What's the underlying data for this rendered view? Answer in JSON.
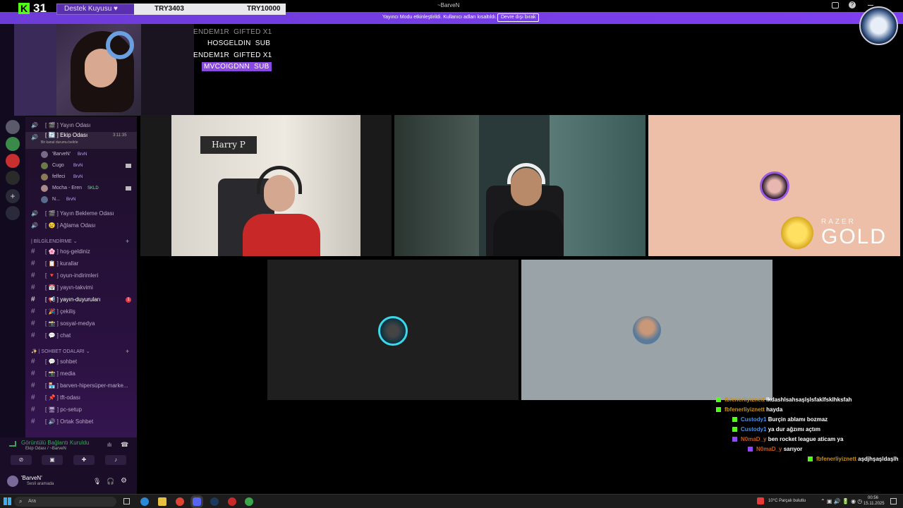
{
  "titlebar": {
    "title": "~BarveN"
  },
  "banner": {
    "text": "Yayıncı Modu etkinleştirildi. Kullanıcı adları kısaltıldı.",
    "button": "Devre dışı bırak"
  },
  "overlay": {
    "kick_count": "31",
    "destek": "Destek Kuyusu ♥",
    "try_left": "TRY3403",
    "try_right": "TRY10000",
    "sub_rows": [
      {
        "name": "ENDEM1R",
        "type": "GIFTED X1"
      },
      {
        "name": "HOSGELDIN",
        "type": "SUB"
      },
      {
        "name": "ENDEM1R",
        "type": "GIFTED X1"
      },
      {
        "name": "MVCOIGDNN",
        "type": "SUB"
      }
    ]
  },
  "sidebar": {
    "voice_top": [
      {
        "label": "[ 🎬 ] Yayın Odası"
      },
      {
        "label": "[ 🔄 ] Ekip Odası",
        "timer": "3:11:35",
        "status": "Bir kanal durumu belirle"
      }
    ],
    "members": [
      {
        "name": "'BarveN'",
        "tag": "BrvN"
      },
      {
        "name": "Cugo",
        "tag": "BrvN"
      },
      {
        "name": "felfeci",
        "tag": "BrvN"
      },
      {
        "name": "Mocha - Eren",
        "tag": "SKLD"
      },
      {
        "name": "N...",
        "tag": "BrvN"
      }
    ],
    "voice_bottom": [
      {
        "label": "[ 🎬 ] Yayın Bekleme Odası"
      },
      {
        "label": "[ 😢 ] Ağlama Odası"
      }
    ],
    "cat1": "| BİLGİLENDİRME ⌄",
    "info_channels": [
      {
        "label": "[ 🌸 ] hoş-geldiniz"
      },
      {
        "label": "[ 📋 ] kurallar"
      },
      {
        "label": "[ 🔻 ] oyun-indirimleri"
      },
      {
        "label": "[ 📅 ] yayın-takvimi"
      },
      {
        "label": "[ 📢 ] yayın-duyuruları",
        "badge": "1"
      },
      {
        "label": "[ 🎉 ] çekiliş"
      },
      {
        "label": "[ 📸 ] sosyal-medya"
      },
      {
        "label": "[ 💬 ] chat"
      }
    ],
    "cat2": "✨ | SOHBET ODALARI ⌄",
    "chat_channels": [
      {
        "label": "[ 💬 ] sohbet"
      },
      {
        "label": "[ 📸 ] media"
      },
      {
        "label": "[ 🏪 ] barven-hipersüper-marke..."
      },
      {
        "label": "[ 📌 ] tft-odası"
      },
      {
        "label": "[ 🖥 ] pc-setup"
      },
      {
        "label": "[ 🔊 ] Ortak Sohbet"
      }
    ]
  },
  "voicepanel": {
    "title": "Görüntülü Bağlantı Kuruldu",
    "sub": "Ekip Odası / ~BarveN"
  },
  "user": {
    "name": "'BarveN'",
    "status": "Sesli aramada"
  },
  "tiles": [
    {
      "kind": "video-girl"
    },
    {
      "kind": "video-man"
    },
    {
      "kind": "avatar-peach",
      "brand_word1": "RAZER",
      "brand_word2": "GOLD"
    },
    {
      "kind": "avatar-dark"
    },
    {
      "kind": "avatar-grey"
    }
  ],
  "chat": [
    {
      "user": "fbfenerliyiznett",
      "msg": "lkdashlsahsaşlşlsfaklfsklhksfah",
      "src": "kick",
      "color": "#c8901a"
    },
    {
      "user": "fbfenerliyiznett",
      "msg": "hayda",
      "src": "kick",
      "color": "#c8901a"
    },
    {
      "user": "Custody1",
      "msg": "Burçin ablamı bozmaz",
      "src": "kick",
      "color": "#4a90e2"
    },
    {
      "user": "Custody1",
      "msg": "ya dur ağzımı açtım",
      "src": "kick",
      "color": "#4a90e2"
    },
    {
      "user": "N0maD_y",
      "msg": "ben rocket league aticam ya",
      "src": "twitch",
      "color": "#c85a1a"
    },
    {
      "user": "N0maD_y",
      "msg": "sarıyor",
      "src": "twitch",
      "color": "#c85a1a"
    },
    {
      "user": "fbfenerliyiznett",
      "msg": "aşdjhşaşldaşlh",
      "src": "kick",
      "color": "#c8901a"
    }
  ],
  "taskbar": {
    "search": "Ara",
    "weather": "10°C  Parçalı bulutlu",
    "time": "00:56",
    "date": "15.11.2025"
  }
}
